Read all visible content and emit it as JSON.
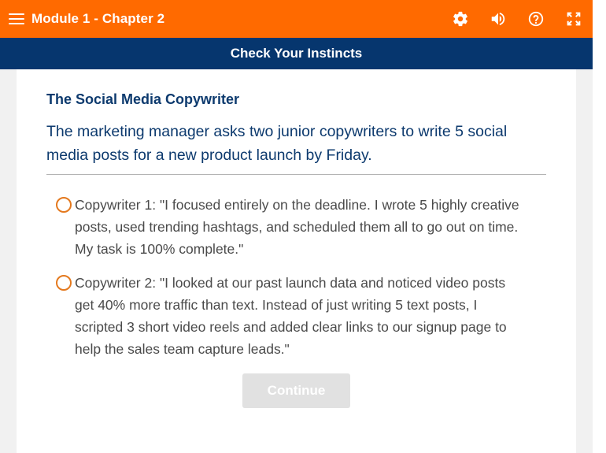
{
  "header": {
    "title": "Module 1 - Chapter 2",
    "icons": [
      "menu-icon",
      "gear-icon",
      "volume-icon",
      "help-icon",
      "fullscreen-icon"
    ],
    "bg_color": "#ff6a00"
  },
  "subheader": {
    "title": "Check Your Instincts",
    "bg_color": "#06366e"
  },
  "question": {
    "title": "The Social Media Copywriter",
    "prompt": "The marketing manager asks two junior copywriters to write 5 social media posts for a new product launch by Friday.",
    "options": [
      {
        "label": "Copywriter 1: \"I focused entirely on the deadline. I wrote 5 highly creative posts, used trending hashtags, and scheduled them all to go out on time. My task is 100% complete.\""
      },
      {
        "label": "Copywriter 2: \"I looked at our past launch data and noticed video posts get 40% more traffic than text. Instead of just writing 5 text posts, I scripted 3 short video reels and added clear links to our signup page to help the sales team capture leads.\""
      }
    ],
    "radio_color": "#e4791e"
  },
  "actions": {
    "continue_label": "Continue",
    "continue_enabled": false
  }
}
